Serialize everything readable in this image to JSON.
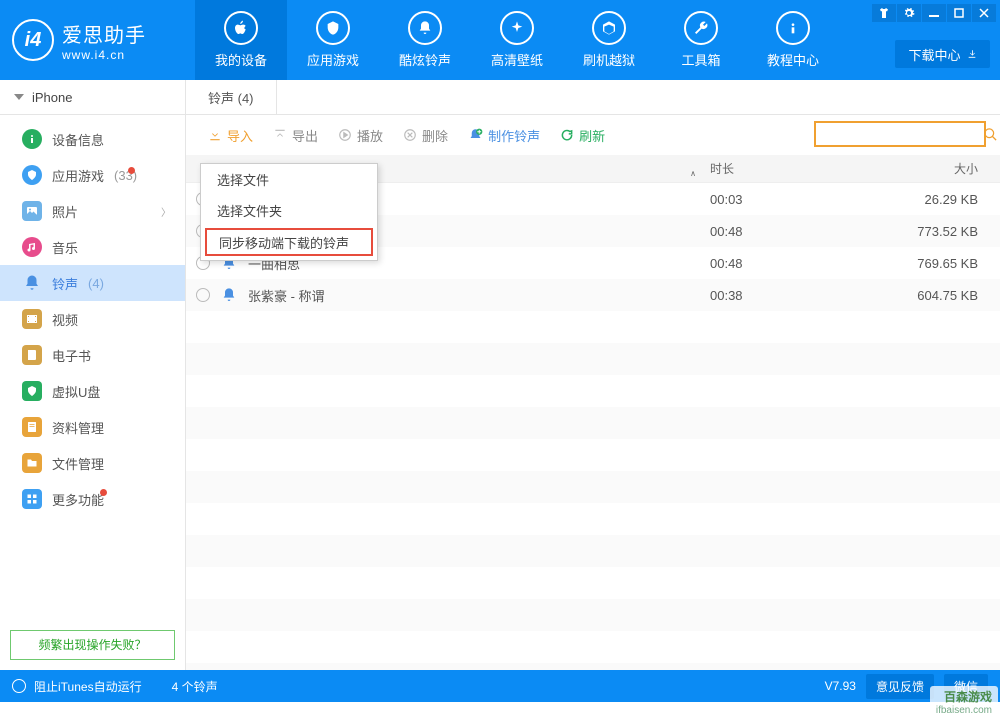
{
  "brand": {
    "cn": "爱思助手",
    "url": "www.i4.cn",
    "badge": "i4"
  },
  "window_controls": {
    "tshirt": "tshirt-icon",
    "gear": "gear-icon",
    "min": "minimize",
    "max": "maximize",
    "close": "close"
  },
  "nav": [
    {
      "label": "我的设备",
      "icon": "apple"
    },
    {
      "label": "应用游戏",
      "icon": "appstore"
    },
    {
      "label": "酷炫铃声",
      "icon": "bell"
    },
    {
      "label": "高清壁纸",
      "icon": "sparkle"
    },
    {
      "label": "刷机越狱",
      "icon": "box"
    },
    {
      "label": "工具箱",
      "icon": "wrench"
    },
    {
      "label": "教程中心",
      "icon": "info"
    }
  ],
  "dl_center": "下载中心",
  "device": "iPhone",
  "sidebar": [
    {
      "label": "设备信息",
      "color": "#27ae60",
      "icon": "info",
      "round": true
    },
    {
      "label": "应用游戏",
      "color": "#3ea0f2",
      "icon": "grid",
      "round": true,
      "count": "(33)",
      "dot": true
    },
    {
      "label": "照片",
      "color": "#6fb3e8",
      "icon": "photo",
      "round": false,
      "expand": true
    },
    {
      "label": "音乐",
      "color": "#e74c8c",
      "icon": "music",
      "round": true
    },
    {
      "label": "铃声",
      "color": "#4a90e2",
      "icon": "bell",
      "round": false,
      "count": "(4)",
      "active": true
    },
    {
      "label": "视频",
      "color": "#d4a44a",
      "icon": "film",
      "round": false
    },
    {
      "label": "电子书",
      "color": "#d4a44a",
      "icon": "book",
      "round": false
    },
    {
      "label": "虚拟U盘",
      "color": "#27ae60",
      "icon": "shield",
      "round": false
    },
    {
      "label": "资料管理",
      "color": "#e8a43a",
      "icon": "doc",
      "round": false
    },
    {
      "label": "文件管理",
      "color": "#e8a43a",
      "icon": "folder",
      "round": false
    },
    {
      "label": "更多功能",
      "color": "#3ea0f2",
      "icon": "grid4",
      "round": false,
      "dot": true
    }
  ],
  "help_link": "频繁出现操作失败？",
  "tab_label": "铃声 (4)",
  "toolbar": {
    "import": "导入",
    "export": "导出",
    "play": "播放",
    "delete": "删除",
    "make": "制作铃声",
    "refresh": "刷新",
    "search_placeholder": ""
  },
  "dropdown": {
    "opt1": "选择文件",
    "opt2": "选择文件夹",
    "opt3": "同步移动端下载的铃声"
  },
  "columns": {
    "name_sort": "∧",
    "duration": "时长",
    "size": "大小"
  },
  "rows": [
    {
      "name": "",
      "dur": "00:03",
      "size": "26.29 KB"
    },
    {
      "name": "",
      "dur": "00:48",
      "size": "773.52 KB"
    },
    {
      "name": "一曲相思",
      "dur": "00:48",
      "size": "769.65 KB"
    },
    {
      "name": "张紫豪 - 称谓",
      "dur": "00:38",
      "size": "604.75 KB"
    }
  ],
  "footer": {
    "itunes": "阻止iTunes自动运行",
    "count": "4 个铃声",
    "version": "V7.93",
    "feedback": "意见反馈",
    "wechat": "微信"
  },
  "watermark": {
    "cn": "百森游戏",
    "url": "ifbaisen.com"
  }
}
